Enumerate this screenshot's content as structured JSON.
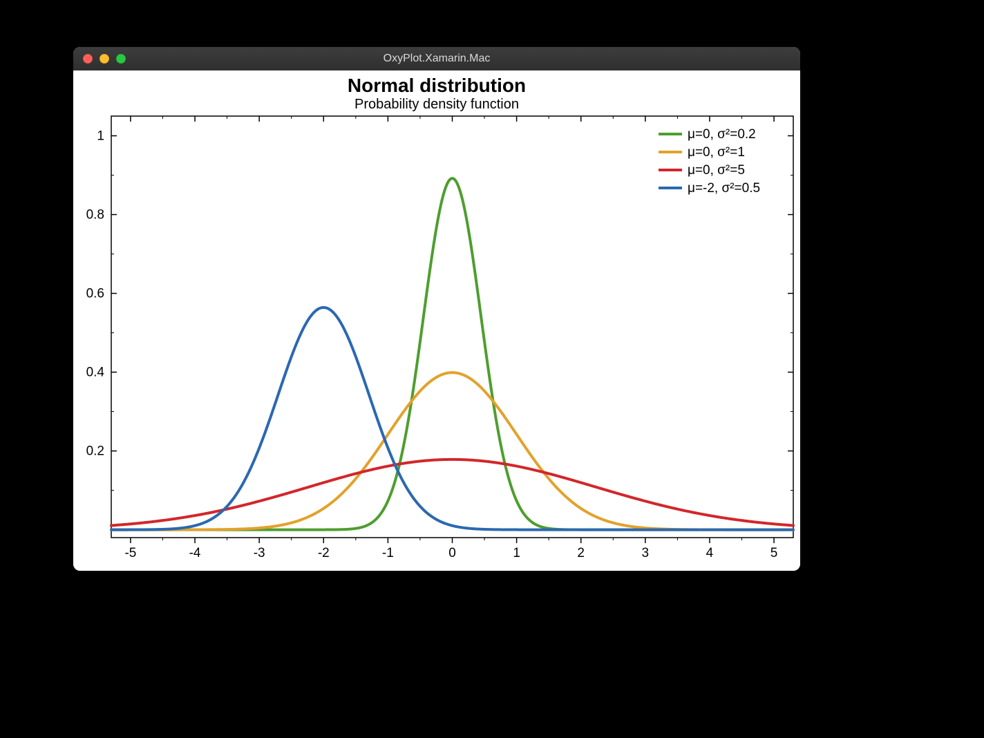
{
  "window": {
    "title": "OxyPlot.Xamarin.Mac"
  },
  "chart_data": {
    "type": "line",
    "title": "Normal distribution",
    "subtitle": "Probability density function",
    "xlabel": "",
    "ylabel": "",
    "xlim": [
      -5.3,
      5.3
    ],
    "ylim": [
      -0.02,
      1.05
    ],
    "x_ticks": [
      -5,
      -4,
      -3,
      -2,
      -1,
      0,
      1,
      2,
      3,
      4,
      5
    ],
    "y_ticks": [
      0.2,
      0.4,
      0.6,
      0.8,
      1
    ],
    "series": [
      {
        "name": "μ=0, σ²=0.2",
        "color": "#4e9e2f",
        "mu": 0,
        "sigma2": 0.2
      },
      {
        "name": "μ=0, σ²=1",
        "color": "#e2a22b",
        "mu": 0,
        "sigma2": 1
      },
      {
        "name": "μ=0, σ²=5",
        "color": "#d3262a",
        "mu": 0,
        "sigma2": 5
      },
      {
        "name": "μ=-2, σ²=0.5",
        "color": "#2b68b0",
        "mu": -2,
        "sigma2": 0.5
      }
    ]
  }
}
